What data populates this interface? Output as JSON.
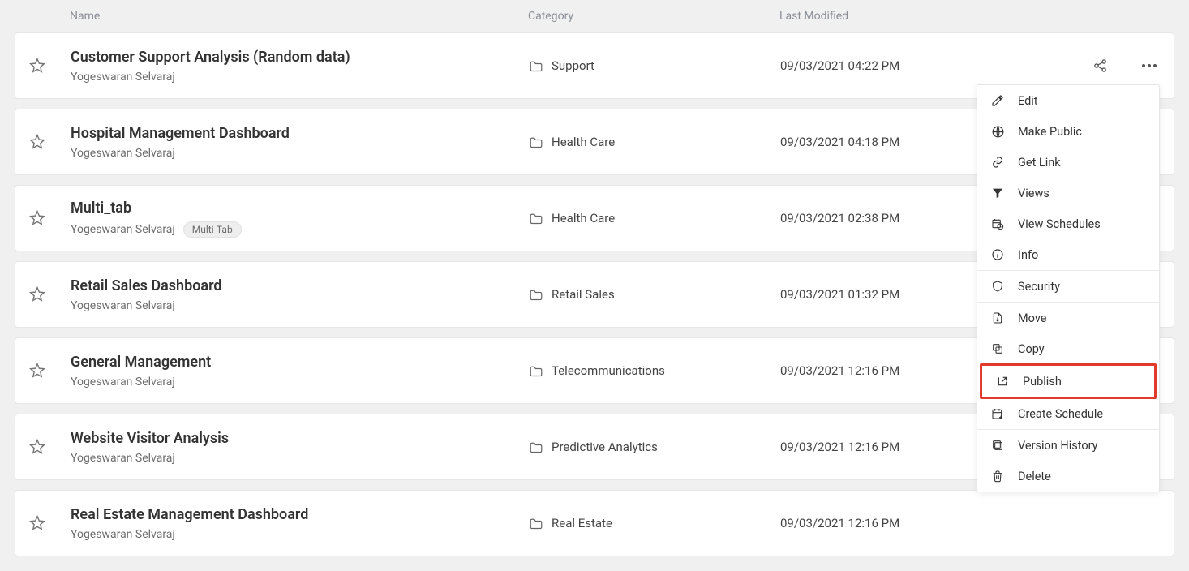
{
  "columns": {
    "name": "Name",
    "category": "Category",
    "modified": "Last Modified"
  },
  "tags": {
    "multitab": "Multi-Tab"
  },
  "rows": [
    {
      "title": "Customer Support Analysis (Random data)",
      "owner": "Yogeswaran Selvaraj",
      "category": "Support",
      "modified": "09/03/2021 04:22 PM",
      "showActions": true
    },
    {
      "title": "Hospital Management Dashboard",
      "owner": "Yogeswaran Selvaraj",
      "category": "Health Care",
      "modified": "09/03/2021 04:18 PM"
    },
    {
      "title": "Multi_tab",
      "owner": "Yogeswaran Selvaraj",
      "tag": "multitab",
      "category": "Health Care",
      "modified": "09/03/2021 02:38 PM"
    },
    {
      "title": "Retail Sales Dashboard",
      "owner": "Yogeswaran Selvaraj",
      "category": "Retail Sales",
      "modified": "09/03/2021 01:32 PM"
    },
    {
      "title": "General Management",
      "owner": "Yogeswaran Selvaraj",
      "category": "Telecommunications",
      "modified": "09/03/2021 12:16 PM"
    },
    {
      "title": "Website Visitor Analysis",
      "owner": "Yogeswaran Selvaraj",
      "category": "Predictive Analytics",
      "modified": "09/03/2021 12:16 PM"
    },
    {
      "title": "Real Estate Management Dashboard",
      "owner": "Yogeswaran Selvaraj",
      "category": "Real Estate",
      "modified": "09/03/2021 12:16 PM"
    }
  ],
  "menu": {
    "edit": "Edit",
    "make_public": "Make Public",
    "get_link": "Get Link",
    "views": "Views",
    "view_schedules": "View Schedules",
    "info": "Info",
    "security": "Security",
    "move": "Move",
    "copy": "Copy",
    "publish": "Publish",
    "create_schedule": "Create Schedule",
    "version_history": "Version History",
    "delete": "Delete"
  }
}
